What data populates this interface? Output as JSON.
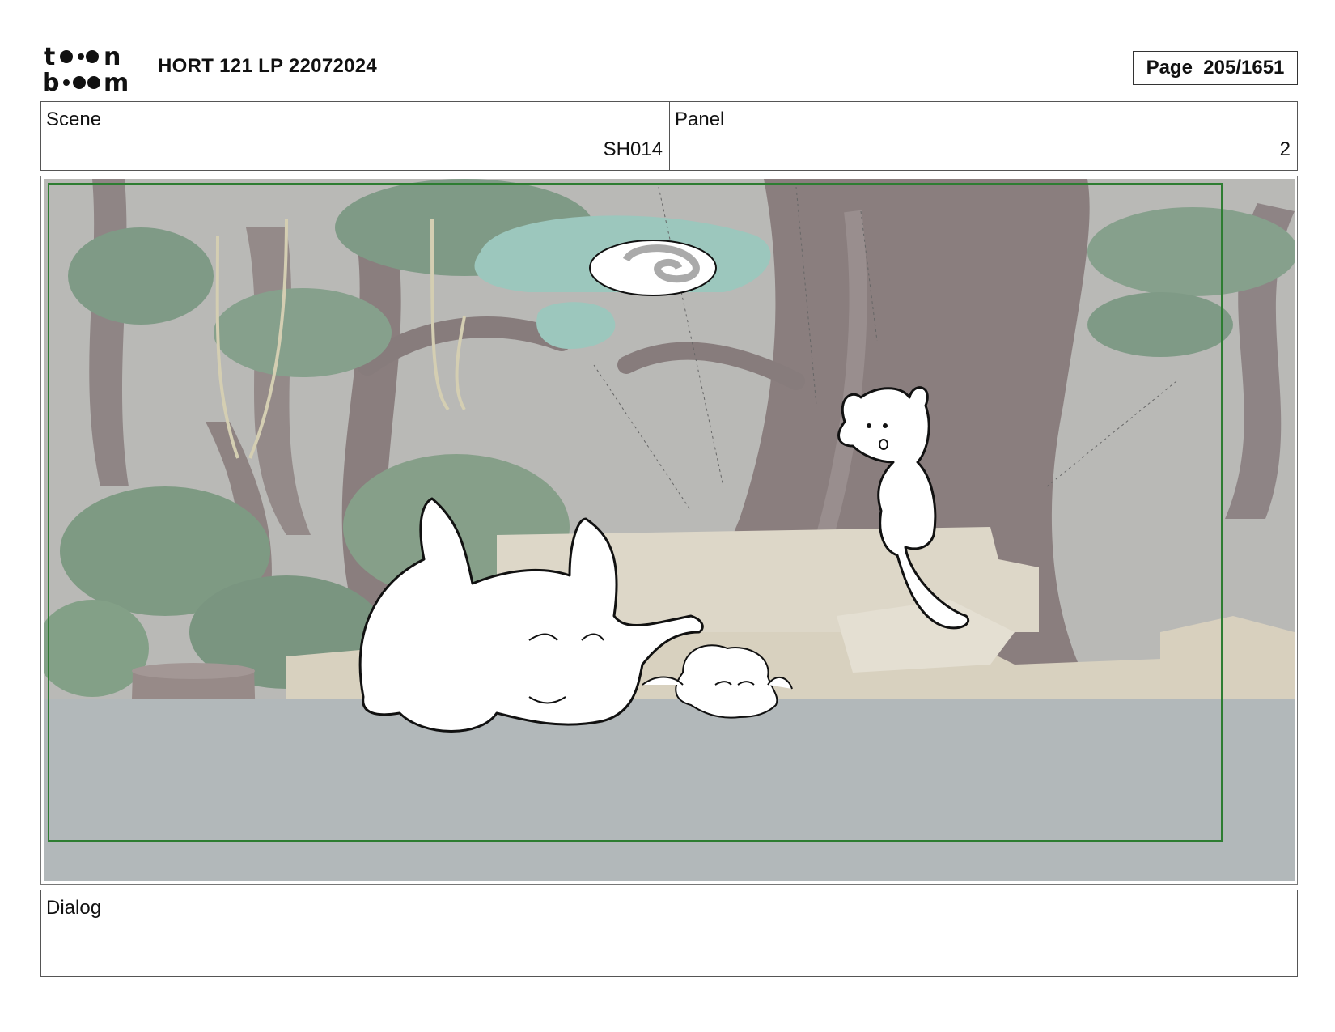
{
  "header": {
    "logo_text_top": "toon",
    "logo_text_bottom": "boom",
    "project_title": "HORT 121 LP 22072024",
    "page_label": "Page",
    "page_number": "205/1651"
  },
  "info": {
    "scene_label": "Scene",
    "scene_value": "SH014",
    "panel_label": "Panel",
    "panel_value": "2"
  },
  "dialog": {
    "label": "Dialog",
    "text": ""
  },
  "colors": {
    "frame_border": "#2e7d32",
    "background_wash": "#b9b9b6",
    "ground": "#b2b8ba",
    "tree_trunk": "#8a7e7e",
    "foliage": "#7f9a86",
    "mushroom_cap": "#9cc7bd"
  }
}
